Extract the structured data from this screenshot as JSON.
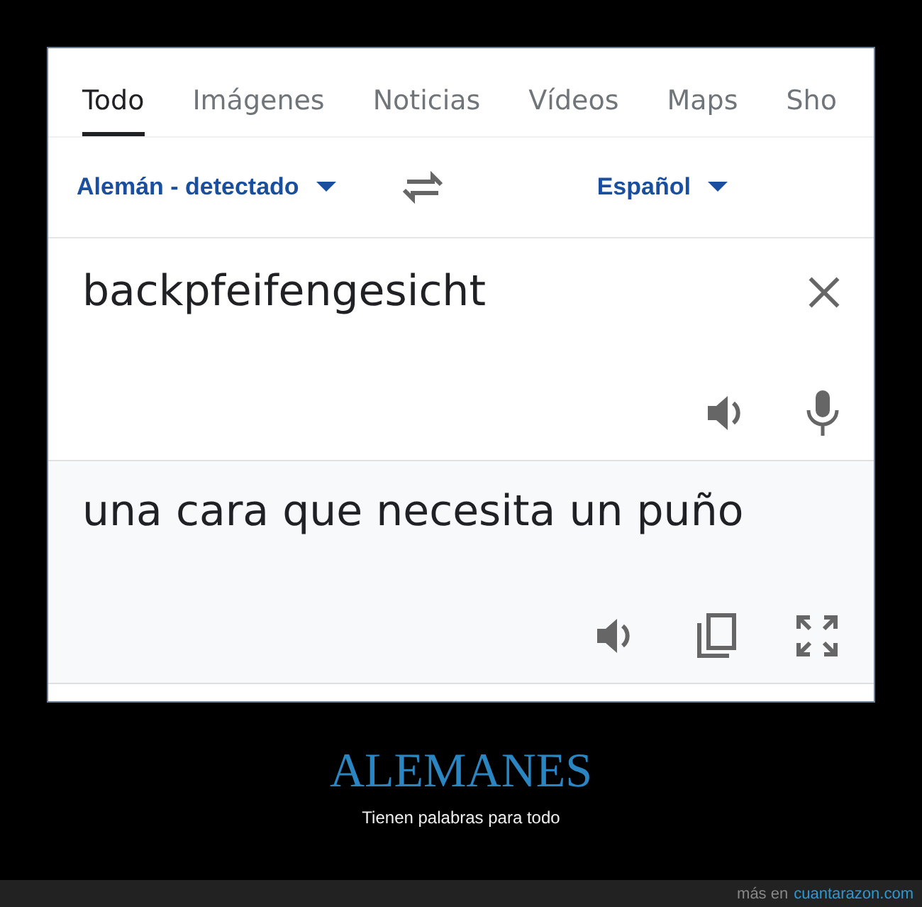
{
  "tabs": [
    {
      "label": "Todo",
      "selected": true
    },
    {
      "label": "Imágenes",
      "selected": false
    },
    {
      "label": "Noticias",
      "selected": false
    },
    {
      "label": "Vídeos",
      "selected": false
    },
    {
      "label": "Maps",
      "selected": false
    },
    {
      "label": "Sho",
      "selected": false
    }
  ],
  "languages": {
    "source": "Alemán - detectado",
    "target": "Español"
  },
  "input": {
    "value": "backpfeifengesicht"
  },
  "output": {
    "text": "una cara que necesita un puño"
  },
  "caption": {
    "title": "ALEMANES",
    "subtitle": "Tienen palabras para todo"
  },
  "footer": {
    "prefix": "más en",
    "link": "cuantarazon.com"
  }
}
